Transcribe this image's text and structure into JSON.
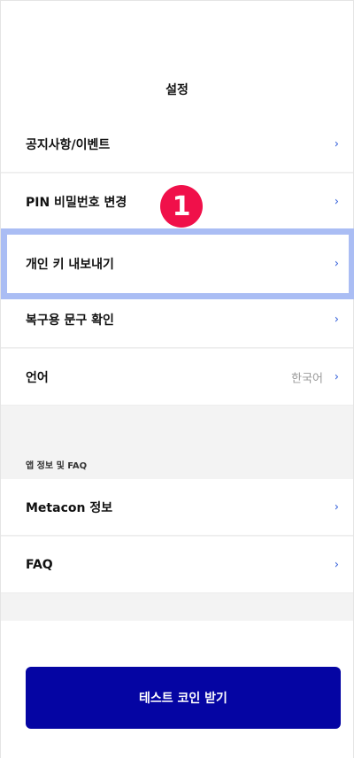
{
  "header": {
    "title": "설정"
  },
  "settings": {
    "items": [
      {
        "label": "공지사항/이벤트",
        "chevron": "›"
      },
      {
        "label": "PIN 비밀번호 변경",
        "chevron": "›"
      },
      {
        "label": "개인 키 내보내기",
        "chevron": "›"
      },
      {
        "label": "복구용 문구 확인",
        "chevron": "›"
      },
      {
        "label": "언어",
        "value": "한국어",
        "chevron": "›"
      }
    ]
  },
  "app_info": {
    "section_label": "앱 정보 및 FAQ",
    "items": [
      {
        "label": "Metacon 정보",
        "chevron": "›"
      },
      {
        "label": "FAQ",
        "chevron": "›"
      }
    ]
  },
  "annotation": {
    "step_number": "1"
  },
  "actions": {
    "test_coin_button": "테스트 코인 받기"
  },
  "colors": {
    "accent": "#2e5bd9",
    "button": "#0505a3",
    "badge": "#f0104a",
    "highlight": "#aabdf4"
  }
}
